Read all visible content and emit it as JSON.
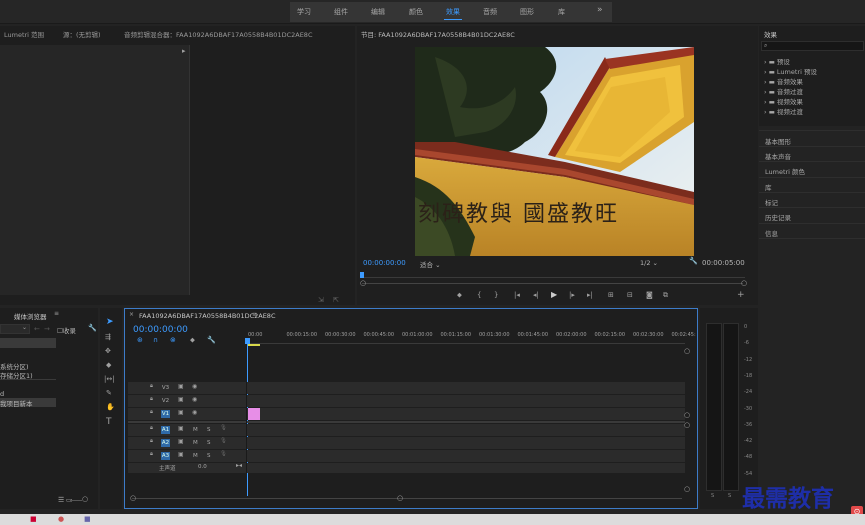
{
  "workspace_tabs": [
    {
      "label": "学习",
      "active": false
    },
    {
      "label": "组件",
      "active": false
    },
    {
      "label": "编辑",
      "active": false
    },
    {
      "label": "颜色",
      "active": false
    },
    {
      "label": "效果",
      "active": true
    },
    {
      "label": "音频",
      "active": false
    },
    {
      "label": "图形",
      "active": false
    },
    {
      "label": "库",
      "active": false
    }
  ],
  "more_label": "»",
  "left_panel": {
    "tab_lumetri": "Lumetri 范围",
    "tab_source": "源：(无剪辑)",
    "tab_mixer": "音频剪辑混合器：FAA1092A6DBAF17A0558B4B01DC2AE8C"
  },
  "program": {
    "title": "节目: FAA1092A6DBAF17A0558B4B01DC2AE8C",
    "timecode": "00:00:00:00",
    "fit": "适合",
    "resolution": "1/2",
    "duration": "00:00:05:00",
    "image_text": "刻碑教與 國盛教旺"
  },
  "effects": {
    "title": "效果",
    "tree": [
      "预设",
      "Lumetri 预设",
      "音频效果",
      "音频过渡",
      "视频效果",
      "视频过渡"
    ],
    "sections": [
      "基本图形",
      "基本声音",
      "Lumetri 颜色",
      "库",
      "标记",
      "历史记录",
      "信息"
    ]
  },
  "media": {
    "title": "媒体浏览器",
    "ingest": "收录",
    "items": [
      "系统分区)",
      "存储分区1)",
      "d",
      "我项目新本"
    ]
  },
  "timeline": {
    "title": "FAA1092A6DBAF17A0558B4B01DC2AE8C",
    "timecode": "00:00:00:00",
    "ruler": [
      "00:00",
      "00:00:15:00",
      "00:00:30:00",
      "00:00:45:00",
      "00:01:00:00",
      "00:01:15:00",
      "00:01:30:00",
      "00:01:45:00",
      "00:02:00:00",
      "00:02:15:00",
      "00:02:30:00",
      "00:02:45:"
    ],
    "video_tracks": [
      "V3",
      "V2",
      "V1"
    ],
    "audio_tracks": [
      "A1",
      "A2",
      "A3"
    ],
    "master": "主声道",
    "master_value": "0.0",
    "m": "M",
    "s": "S"
  },
  "meter": {
    "scale": [
      "0",
      "-6",
      "-12",
      "-18",
      "-24",
      "-30",
      "-36",
      "-42",
      "-48",
      "-54"
    ],
    "ch_l": "S",
    "ch_r": "S"
  },
  "watermark": "最需教育",
  "colors": {
    "accent": "#3d9bff",
    "clip": "#e78ee7",
    "watermark": "#1e2ea8"
  }
}
